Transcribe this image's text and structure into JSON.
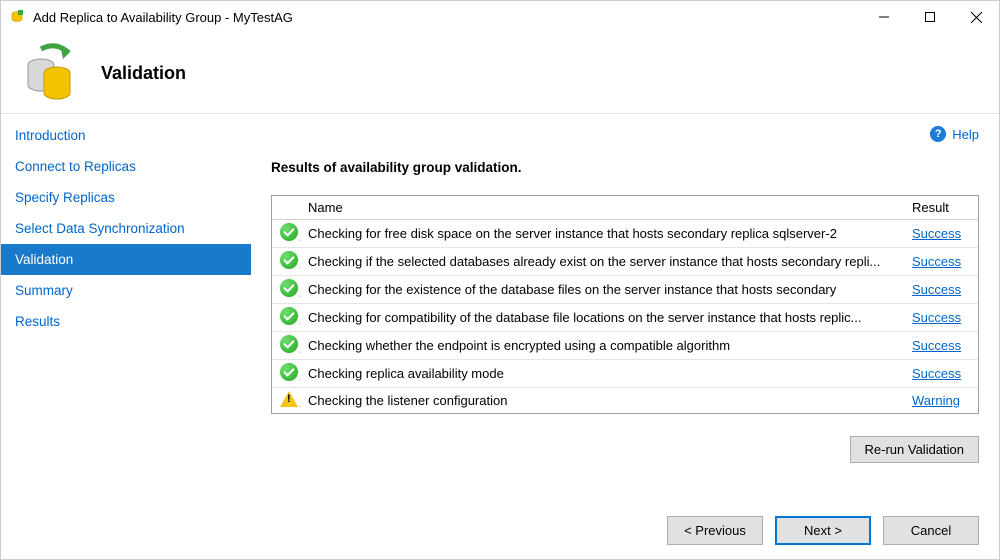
{
  "window": {
    "title": "Add Replica to Availability Group - MyTestAG"
  },
  "header": {
    "page_title": "Validation"
  },
  "sidebar": {
    "steps": [
      {
        "label": "Introduction",
        "active": false
      },
      {
        "label": "Connect to Replicas",
        "active": false
      },
      {
        "label": "Specify Replicas",
        "active": false
      },
      {
        "label": "Select Data Synchronization",
        "active": false
      },
      {
        "label": "Validation",
        "active": true
      },
      {
        "label": "Summary",
        "active": false
      },
      {
        "label": "Results",
        "active": false
      }
    ]
  },
  "main": {
    "help_label": "Help",
    "results_title": "Results of availability group validation.",
    "columns": {
      "name": "Name",
      "result": "Result"
    },
    "rows": [
      {
        "status": "success",
        "name": "Checking for free disk space on the server instance that hosts secondary replica sqlserver-2",
        "result": "Success"
      },
      {
        "status": "success",
        "name": "Checking if the selected databases already exist on the server instance that hosts secondary repli...",
        "result": "Success"
      },
      {
        "status": "success",
        "name": "Checking for the existence of the database files on the server instance that hosts secondary",
        "result": "Success"
      },
      {
        "status": "success",
        "name": "Checking for compatibility of the database file locations on the server instance that hosts replic...",
        "result": "Success"
      },
      {
        "status": "success",
        "name": "Checking whether the endpoint is encrypted using a compatible algorithm",
        "result": "Success"
      },
      {
        "status": "success",
        "name": "Checking replica availability mode",
        "result": "Success"
      },
      {
        "status": "warning",
        "name": "Checking the listener configuration",
        "result": "Warning"
      }
    ],
    "rerun_label": "Re-run Validation"
  },
  "footer": {
    "previous": "< Previous",
    "next": "Next >",
    "cancel": "Cancel"
  }
}
